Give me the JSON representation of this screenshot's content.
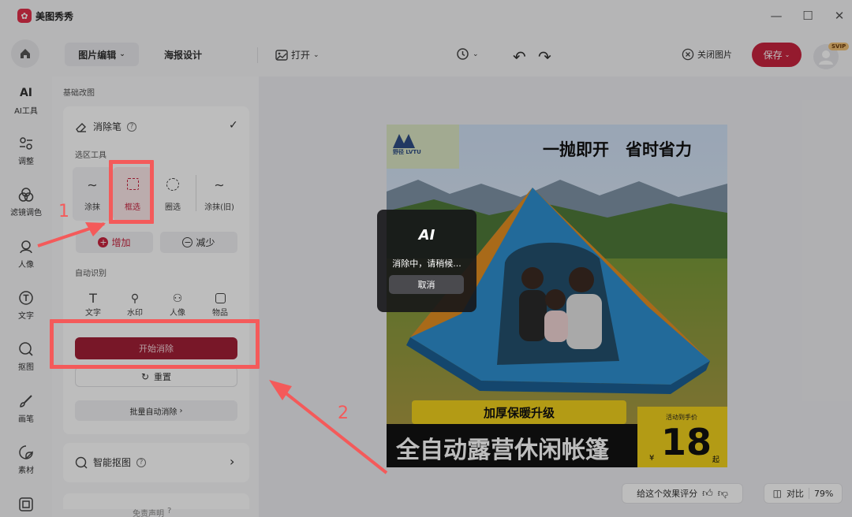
{
  "app": {
    "title": "美图秀秀"
  },
  "header": {
    "tabs": [
      "图片编辑",
      "海报设计"
    ],
    "open_label": "打开",
    "close_image_label": "关闭图片",
    "save_label": "保存",
    "vip_badge": "SVIP"
  },
  "left_nav": [
    {
      "label": "AI工具",
      "icon": "ai-icon"
    },
    {
      "label": "调整",
      "icon": "adjust-icon"
    },
    {
      "label": "滤镜调色",
      "icon": "filter-icon"
    },
    {
      "label": "人像",
      "icon": "portrait-icon"
    },
    {
      "label": "文字",
      "icon": "text-icon"
    },
    {
      "label": "抠图",
      "icon": "cutout-icon"
    },
    {
      "label": "画笔",
      "icon": "brush-icon"
    },
    {
      "label": "素材",
      "icon": "sticker-icon"
    }
  ],
  "panel": {
    "section_title": "基础改图",
    "tool_name": "消除笔",
    "select_label": "选区工具",
    "select_tools": [
      "涂抹",
      "框选",
      "圈选",
      "涂抹(旧)"
    ],
    "add_label": "增加",
    "reduce_label": "减少",
    "auto_label": "自动识别",
    "auto_tools": [
      "文字",
      "水印",
      "人像",
      "物品"
    ],
    "start_label": "开始消除",
    "reset_label": "重置",
    "batch_label": "批量自动消除",
    "smart_cutout_label": "智能抠图",
    "disclaimer": "免责声明"
  },
  "poster": {
    "brand": "野径 LVTU",
    "headline": "一抛即开　省时省力",
    "banner": "加厚保暖升级",
    "title": "全自动露营休闲帐篷",
    "price_label": "活动到手价",
    "currency": "¥",
    "price": "18",
    "price_suffix": "起"
  },
  "progress": {
    "logo": "AI",
    "message": "消除中，请稍候...",
    "cancel_label": "取消"
  },
  "bottom": {
    "rate_label": "给这个效果评分",
    "compare_label": "对比",
    "zoom": "79%"
  },
  "annotations": {
    "step1": "1",
    "step2": "2"
  },
  "colors": {
    "brand": "#c8243f",
    "annotation": "#f45a5a"
  }
}
